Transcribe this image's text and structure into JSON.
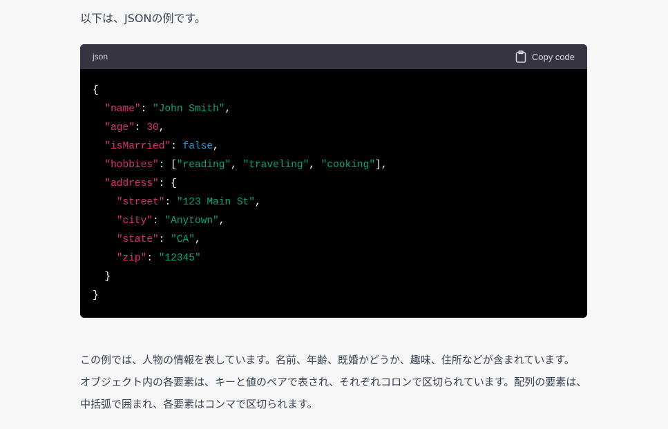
{
  "intro_text": "以下は、JSONの例です。",
  "code_block": {
    "language": "json",
    "copy_label": "Copy code",
    "lines": [
      [
        {
          "t": "p",
          "v": "{"
        }
      ],
      [
        {
          "t": "p",
          "v": "  "
        },
        {
          "t": "k",
          "v": "\"name\""
        },
        {
          "t": "p",
          "v": ": "
        },
        {
          "t": "s",
          "v": "\"John Smith\""
        },
        {
          "t": "p",
          "v": ","
        }
      ],
      [
        {
          "t": "p",
          "v": "  "
        },
        {
          "t": "k",
          "v": "\"age\""
        },
        {
          "t": "p",
          "v": ": "
        },
        {
          "t": "n",
          "v": "30"
        },
        {
          "t": "p",
          "v": ","
        }
      ],
      [
        {
          "t": "p",
          "v": "  "
        },
        {
          "t": "k",
          "v": "\"isMarried\""
        },
        {
          "t": "p",
          "v": ": "
        },
        {
          "t": "b",
          "v": "false"
        },
        {
          "t": "p",
          "v": ","
        }
      ],
      [
        {
          "t": "p",
          "v": "  "
        },
        {
          "t": "k",
          "v": "\"hobbies\""
        },
        {
          "t": "p",
          "v": ": ["
        },
        {
          "t": "s",
          "v": "\"reading\""
        },
        {
          "t": "p",
          "v": ", "
        },
        {
          "t": "s",
          "v": "\"traveling\""
        },
        {
          "t": "p",
          "v": ", "
        },
        {
          "t": "s",
          "v": "\"cooking\""
        },
        {
          "t": "p",
          "v": "],"
        }
      ],
      [
        {
          "t": "p",
          "v": "  "
        },
        {
          "t": "k",
          "v": "\"address\""
        },
        {
          "t": "p",
          "v": ": {"
        }
      ],
      [
        {
          "t": "p",
          "v": "    "
        },
        {
          "t": "k",
          "v": "\"street\""
        },
        {
          "t": "p",
          "v": ": "
        },
        {
          "t": "s",
          "v": "\"123 Main St\""
        },
        {
          "t": "p",
          "v": ","
        }
      ],
      [
        {
          "t": "p",
          "v": "    "
        },
        {
          "t": "k",
          "v": "\"city\""
        },
        {
          "t": "p",
          "v": ": "
        },
        {
          "t": "s",
          "v": "\"Anytown\""
        },
        {
          "t": "p",
          "v": ","
        }
      ],
      [
        {
          "t": "p",
          "v": "    "
        },
        {
          "t": "k",
          "v": "\"state\""
        },
        {
          "t": "p",
          "v": ": "
        },
        {
          "t": "s",
          "v": "\"CA\""
        },
        {
          "t": "p",
          "v": ","
        }
      ],
      [
        {
          "t": "p",
          "v": "    "
        },
        {
          "t": "k",
          "v": "\"zip\""
        },
        {
          "t": "p",
          "v": ": "
        },
        {
          "t": "s",
          "v": "\"12345\""
        }
      ],
      [
        {
          "t": "p",
          "v": "  }"
        }
      ],
      [
        {
          "t": "p",
          "v": "}"
        }
      ]
    ]
  },
  "explanation_lines": [
    "この例では、人物の情報を表しています。名前、年齢、既婚かどうか、趣味、住所などが含まれています。",
    "オブジェクト内の各要素は、キーと値のペアで表され、それぞれコロンで区切られています。配列の要素は、",
    "中括弧で囲まれ、各要素はコンマで区切られます。"
  ],
  "icons": {
    "copy": "clipboard-icon"
  },
  "colors": {
    "page_bg": "#f7f7f8",
    "code_header_bg": "#343541",
    "code_bg": "#000000",
    "key": "#df3079",
    "string": "#00a67d",
    "number": "#df3079",
    "boolean": "#2e95d3"
  }
}
